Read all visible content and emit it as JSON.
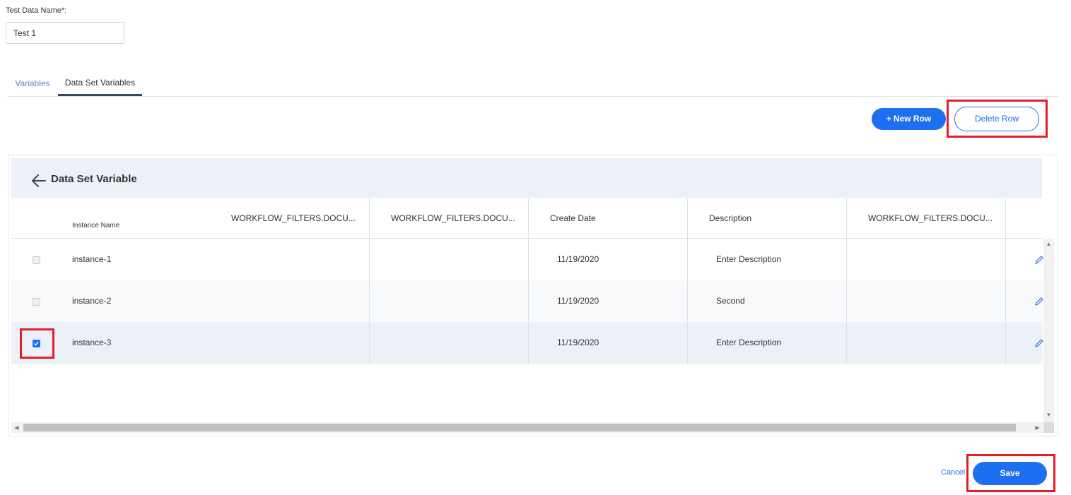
{
  "form": {
    "name_label": "Test Data Name*:",
    "name_value": "Test 1"
  },
  "tabs": [
    {
      "label": "Variables",
      "active": false
    },
    {
      "label": "Data Set Variables",
      "active": true
    }
  ],
  "toolbar": {
    "new_row_icon": "+",
    "new_row_label": "New Row",
    "delete_row_label": "Delete Row"
  },
  "panel": {
    "title": "Data Set Variable",
    "back_icon": "arrow-left-icon"
  },
  "table": {
    "columns": [
      "Instance Name",
      "WORKFLOW_FILTERS.DOCU...",
      "WORKFLOW_FILTERS.DOCU...",
      "Create Date",
      "Description",
      "WORKFLOW_FILTERS.DOCU..."
    ],
    "rows": [
      {
        "checked": false,
        "instance": "instance-1",
        "create_date": "11/19/2020",
        "description": "Enter Description"
      },
      {
        "checked": false,
        "instance": "instance-2",
        "create_date": "11/19/2020",
        "description": "Second"
      },
      {
        "checked": true,
        "instance": "instance-3",
        "create_date": "11/19/2020",
        "description": "Enter Description"
      }
    ]
  },
  "footer": {
    "cancel_label": "Cancel",
    "save_label": "Save"
  },
  "colors": {
    "primary": "#1d6ff0",
    "highlight": "#e51d2a",
    "header_bg": "#ecf1f8"
  }
}
